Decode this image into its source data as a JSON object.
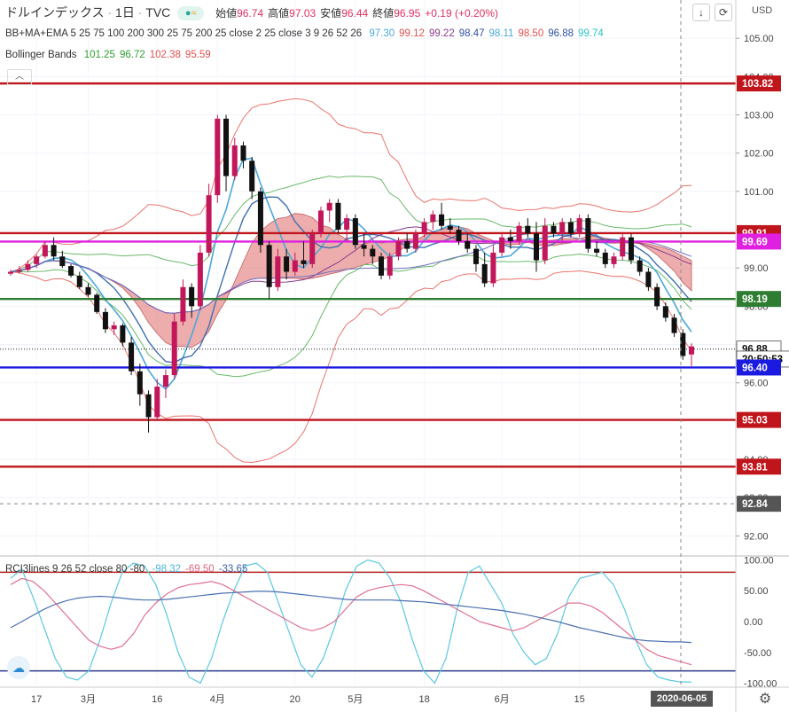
{
  "header": {
    "symbol": "ドルインデックス",
    "interval": "1日",
    "source": "TVC",
    "ohlc": [
      {
        "label": "始値",
        "value": "96.74"
      },
      {
        "label": "高値",
        "value": "97.03"
      },
      {
        "label": "安値",
        "value": "96.44"
      },
      {
        "label": "終値",
        "value": "96.95"
      }
    ],
    "change": "+0.19 (+0.20%)",
    "currency": "USD"
  },
  "indicators": {
    "bbma_label": "BB+MA+EMA 5 25 75 100 200 300 25 75 200 25 close 2 25 close 3 9 26 52 26",
    "bbma_values": [
      {
        "v": "97.30",
        "color": "#4aa8d8"
      },
      {
        "v": "99.12",
        "color": "#e05050"
      },
      {
        "v": "99.22",
        "color": "#8a3a8a"
      },
      {
        "v": "98.47",
        "color": "#3050a0"
      },
      {
        "v": "98.11",
        "color": "#4aa8d8"
      },
      {
        "v": "98.50",
        "color": "#e05050"
      },
      {
        "v": "96.88",
        "color": "#3050a0"
      },
      {
        "v": "99.74",
        "color": "#2ec4c4"
      }
    ],
    "bb_label": "Bollinger Bands",
    "bb_values": [
      {
        "v": "101.25",
        "color": "#2e9e2e"
      },
      {
        "v": "96.72",
        "color": "#2e9e2e"
      },
      {
        "v": "102.38",
        "color": "#e05050"
      },
      {
        "v": "95.59",
        "color": "#e05050"
      }
    ],
    "rci_label": "RCI3lines 9 26 52 close 80 -80",
    "rci_values": [
      {
        "v": "-98.32",
        "color": "#4ab8d8"
      },
      {
        "v": "-69.50",
        "color": "#e06080"
      },
      {
        "v": "-33.65",
        "color": "#4060a0"
      }
    ]
  },
  "price_axis": {
    "ticks": [
      "105.00",
      "104.00",
      "103.00",
      "102.00",
      "101.00",
      "100.00",
      "99.00",
      "98.00",
      "97.00",
      "96.00",
      "95.00",
      "94.00",
      "93.00",
      "92.00"
    ],
    "tags": [
      {
        "name": "level-103-82",
        "text": "103.82",
        "bg": "#c0151b",
        "color": "#ffffff"
      },
      {
        "name": "level-99-91",
        "text": "99.91",
        "bg": "#c0151b",
        "color": "#ffffff"
      },
      {
        "name": "level-99-69",
        "text": "99.69",
        "bg": "#e020e0",
        "color": "#ffffff"
      },
      {
        "name": "level-98-19",
        "text": "98.19",
        "bg": "#2e7d32",
        "color": "#ffffff"
      },
      {
        "name": "last-price",
        "text": "96.88",
        "bg": "#ffffff",
        "color": "#111111"
      },
      {
        "name": "countdown",
        "text": "20:50:53",
        "bg": "#ffffff",
        "color": "#111111"
      },
      {
        "name": "level-96-40",
        "text": "96.40",
        "bg": "#1a1ae0",
        "color": "#ffffff"
      },
      {
        "name": "level-95-03",
        "text": "95.03",
        "bg": "#c0151b",
        "color": "#ffffff"
      },
      {
        "name": "level-93-81",
        "text": "93.81",
        "bg": "#c0151b",
        "color": "#ffffff"
      },
      {
        "name": "crosshair-price",
        "text": "92.84",
        "bg": "#555555",
        "color": "#ffffff"
      }
    ]
  },
  "rci_axis": {
    "ticks": [
      "100.00",
      "50.00",
      "0.00",
      "-50.00",
      "-100.00"
    ]
  },
  "time_axis": {
    "ticks": [
      "17",
      "3月",
      "16",
      "4月",
      "20",
      "5月",
      "18",
      "6月",
      "15"
    ],
    "crosshair_date": "2020-06-05"
  },
  "chart_data": {
    "type": "candlestick",
    "title": "ドルインデックス 1日 TVC",
    "ylim": [
      91.5,
      106.0
    ],
    "horizontal_levels": [
      {
        "value": 103.82,
        "color": "#c0151b"
      },
      {
        "value": 99.91,
        "color": "#c0151b"
      },
      {
        "value": 99.69,
        "color": "#e020e0"
      },
      {
        "value": 98.19,
        "color": "#2e7d32"
      },
      {
        "value": 96.4,
        "color": "#1a1ae0"
      },
      {
        "value": 95.03,
        "color": "#c0151b"
      },
      {
        "value": 93.81,
        "color": "#c0151b"
      }
    ],
    "last_price": 96.88,
    "candles": [
      {
        "o": 98.85,
        "h": 98.95,
        "l": 98.8,
        "c": 98.9
      },
      {
        "o": 98.9,
        "h": 99.05,
        "l": 98.85,
        "c": 98.95
      },
      {
        "o": 98.95,
        "h": 99.2,
        "l": 98.9,
        "c": 99.1
      },
      {
        "o": 99.1,
        "h": 99.35,
        "l": 99.0,
        "c": 99.3
      },
      {
        "o": 99.3,
        "h": 99.7,
        "l": 99.25,
        "c": 99.6
      },
      {
        "o": 99.6,
        "h": 99.8,
        "l": 99.2,
        "c": 99.3
      },
      {
        "o": 99.3,
        "h": 99.45,
        "l": 99.0,
        "c": 99.05
      },
      {
        "o": 99.05,
        "h": 99.1,
        "l": 98.75,
        "c": 98.8
      },
      {
        "o": 98.8,
        "h": 98.9,
        "l": 98.45,
        "c": 98.5
      },
      {
        "o": 98.5,
        "h": 98.6,
        "l": 98.25,
        "c": 98.3
      },
      {
        "o": 98.3,
        "h": 98.35,
        "l": 97.8,
        "c": 97.85
      },
      {
        "o": 97.85,
        "h": 97.95,
        "l": 97.3,
        "c": 97.4
      },
      {
        "o": 97.4,
        "h": 97.6,
        "l": 97.25,
        "c": 97.5
      },
      {
        "o": 97.5,
        "h": 97.55,
        "l": 96.95,
        "c": 97.05
      },
      {
        "o": 97.05,
        "h": 97.2,
        "l": 96.2,
        "c": 96.3
      },
      {
        "o": 96.3,
        "h": 96.5,
        "l": 95.4,
        "c": 95.7
      },
      {
        "o": 95.7,
        "h": 95.8,
        "l": 94.7,
        "c": 95.1
      },
      {
        "o": 95.1,
        "h": 96.1,
        "l": 95.0,
        "c": 95.9
      },
      {
        "o": 95.9,
        "h": 96.35,
        "l": 95.6,
        "c": 96.2
      },
      {
        "o": 96.2,
        "h": 97.8,
        "l": 96.1,
        "c": 97.6
      },
      {
        "o": 97.6,
        "h": 98.7,
        "l": 97.5,
        "c": 98.5
      },
      {
        "o": 98.5,
        "h": 98.6,
        "l": 97.7,
        "c": 98.0
      },
      {
        "o": 98.0,
        "h": 99.6,
        "l": 97.9,
        "c": 99.4
      },
      {
        "o": 99.4,
        "h": 101.2,
        "l": 99.3,
        "c": 100.9
      },
      {
        "o": 100.9,
        "h": 103.0,
        "l": 100.7,
        "c": 102.9
      },
      {
        "o": 102.9,
        "h": 103.0,
        "l": 101.0,
        "c": 101.4
      },
      {
        "o": 101.4,
        "h": 102.4,
        "l": 101.3,
        "c": 102.2
      },
      {
        "o": 102.2,
        "h": 102.3,
        "l": 101.6,
        "c": 101.8
      },
      {
        "o": 101.8,
        "h": 101.9,
        "l": 100.8,
        "c": 101.0
      },
      {
        "o": 101.0,
        "h": 101.1,
        "l": 99.4,
        "c": 99.6
      },
      {
        "o": 99.6,
        "h": 99.7,
        "l": 98.2,
        "c": 98.5
      },
      {
        "o": 98.5,
        "h": 99.5,
        "l": 98.4,
        "c": 99.3
      },
      {
        "o": 99.3,
        "h": 99.5,
        "l": 98.7,
        "c": 98.9
      },
      {
        "o": 98.9,
        "h": 99.4,
        "l": 98.8,
        "c": 99.2
      },
      {
        "o": 99.2,
        "h": 99.7,
        "l": 99.0,
        "c": 99.1
      },
      {
        "o": 99.1,
        "h": 100.0,
        "l": 99.0,
        "c": 99.9
      },
      {
        "o": 99.9,
        "h": 100.6,
        "l": 99.8,
        "c": 100.5
      },
      {
        "o": 100.5,
        "h": 100.8,
        "l": 100.2,
        "c": 100.7
      },
      {
        "o": 100.7,
        "h": 100.8,
        "l": 99.9,
        "c": 100.0
      },
      {
        "o": 100.0,
        "h": 100.4,
        "l": 99.7,
        "c": 100.3
      },
      {
        "o": 100.3,
        "h": 100.4,
        "l": 99.5,
        "c": 99.6
      },
      {
        "o": 99.6,
        "h": 99.9,
        "l": 99.3,
        "c": 99.5
      },
      {
        "o": 99.5,
        "h": 99.6,
        "l": 99.1,
        "c": 99.3
      },
      {
        "o": 99.3,
        "h": 99.4,
        "l": 98.7,
        "c": 98.8
      },
      {
        "o": 98.8,
        "h": 99.4,
        "l": 98.7,
        "c": 99.3
      },
      {
        "o": 99.3,
        "h": 99.8,
        "l": 99.2,
        "c": 99.7
      },
      {
        "o": 99.7,
        "h": 99.9,
        "l": 99.4,
        "c": 99.5
      },
      {
        "o": 99.5,
        "h": 100.0,
        "l": 99.4,
        "c": 99.9
      },
      {
        "o": 99.9,
        "h": 100.3,
        "l": 99.8,
        "c": 100.2
      },
      {
        "o": 100.2,
        "h": 100.5,
        "l": 100.0,
        "c": 100.4
      },
      {
        "o": 100.4,
        "h": 100.7,
        "l": 100.0,
        "c": 100.1
      },
      {
        "o": 100.1,
        "h": 100.3,
        "l": 99.9,
        "c": 100.0
      },
      {
        "o": 100.0,
        "h": 100.1,
        "l": 99.6,
        "c": 99.7
      },
      {
        "o": 99.7,
        "h": 99.9,
        "l": 99.4,
        "c": 99.5
      },
      {
        "o": 99.5,
        "h": 99.6,
        "l": 98.9,
        "c": 99.1
      },
      {
        "o": 99.1,
        "h": 99.4,
        "l": 98.5,
        "c": 98.6
      },
      {
        "o": 98.6,
        "h": 99.6,
        "l": 98.5,
        "c": 99.4
      },
      {
        "o": 99.4,
        "h": 99.9,
        "l": 99.3,
        "c": 99.8
      },
      {
        "o": 99.8,
        "h": 100.0,
        "l": 99.5,
        "c": 99.7
      },
      {
        "o": 99.7,
        "h": 100.2,
        "l": 99.6,
        "c": 100.1
      },
      {
        "o": 100.1,
        "h": 100.3,
        "l": 99.8,
        "c": 99.9
      },
      {
        "o": 99.9,
        "h": 100.2,
        "l": 98.9,
        "c": 99.2
      },
      {
        "o": 99.2,
        "h": 100.3,
        "l": 99.1,
        "c": 100.1
      },
      {
        "o": 100.1,
        "h": 100.2,
        "l": 99.8,
        "c": 99.9
      },
      {
        "o": 99.9,
        "h": 100.3,
        "l": 99.7,
        "c": 100.2
      },
      {
        "o": 100.2,
        "h": 100.3,
        "l": 99.8,
        "c": 99.9
      },
      {
        "o": 99.9,
        "h": 100.4,
        "l": 99.8,
        "c": 100.3
      },
      {
        "o": 100.3,
        "h": 100.4,
        "l": 99.4,
        "c": 99.5
      },
      {
        "o": 99.5,
        "h": 99.7,
        "l": 99.3,
        "c": 99.4
      },
      {
        "o": 99.4,
        "h": 99.5,
        "l": 99.0,
        "c": 99.1
      },
      {
        "o": 99.1,
        "h": 99.4,
        "l": 99.0,
        "c": 99.3
      },
      {
        "o": 99.3,
        "h": 99.9,
        "l": 99.2,
        "c": 99.8
      },
      {
        "o": 99.8,
        "h": 99.9,
        "l": 99.1,
        "c": 99.2
      },
      {
        "o": 99.2,
        "h": 99.3,
        "l": 98.8,
        "c": 98.9
      },
      {
        "o": 98.9,
        "h": 99.0,
        "l": 98.4,
        "c": 98.5
      },
      {
        "o": 98.5,
        "h": 98.6,
        "l": 97.9,
        "c": 98.0
      },
      {
        "o": 98.0,
        "h": 98.1,
        "l": 97.6,
        "c": 97.7
      },
      {
        "o": 97.7,
        "h": 97.8,
        "l": 97.2,
        "c": 97.3
      },
      {
        "o": 97.3,
        "h": 97.4,
        "l": 96.6,
        "c": 96.7
      },
      {
        "o": 96.74,
        "h": 97.03,
        "l": 96.44,
        "c": 96.95
      }
    ],
    "rci": {
      "ylim": [
        -105,
        105
      ],
      "levels": [
        80,
        -80
      ],
      "series": [
        {
          "name": "RCI 9",
          "color": "#5bc8e0",
          "values": [
            70,
            85,
            40,
            -10,
            -60,
            -90,
            -95,
            -80,
            -30,
            30,
            80,
            95,
            90,
            60,
            10,
            -50,
            -90,
            -100,
            -60,
            0,
            50,
            90,
            95,
            80,
            30,
            -20,
            -70,
            -90,
            -60,
            -10,
            50,
            90,
            100,
            95,
            70,
            30,
            -30,
            -80,
            -100,
            -60,
            20,
            80,
            90,
            60,
            30,
            -20,
            -50,
            -70,
            -60,
            -20,
            40,
            70,
            75,
            80,
            60,
            20,
            -30,
            -70,
            -90,
            -95,
            -98,
            -98
          ]
        },
        {
          "name": "RCI 26",
          "color": "#e07090",
          "values": [
            60,
            70,
            65,
            50,
            30,
            10,
            -10,
            -30,
            -40,
            -45,
            -40,
            -20,
            10,
            30,
            45,
            55,
            60,
            62,
            65,
            60,
            50,
            40,
            30,
            20,
            10,
            0,
            -10,
            -15,
            -10,
            0,
            20,
            40,
            50,
            55,
            58,
            60,
            58,
            50,
            40,
            30,
            20,
            10,
            0,
            -5,
            -10,
            -15,
            -10,
            0,
            10,
            20,
            30,
            30,
            25,
            15,
            0,
            -15,
            -30,
            -45,
            -55,
            -60,
            -65,
            -70
          ]
        },
        {
          "name": "RCI 52",
          "color": "#4a70b0",
          "values": [
            -10,
            0,
            10,
            20,
            28,
            34,
            38,
            40,
            41,
            40,
            38,
            36,
            35,
            35,
            36,
            38,
            40,
            42,
            44,
            46,
            47,
            48,
            49,
            49,
            48,
            46,
            44,
            42,
            40,
            38,
            36,
            35,
            35,
            35,
            35,
            34,
            33,
            32,
            30,
            28,
            26,
            24,
            22,
            20,
            18,
            15,
            12,
            8,
            4,
            0,
            -5,
            -10,
            -14,
            -18,
            -22,
            -26,
            -29,
            -31,
            -32,
            -33,
            -33,
            -34
          ]
        }
      ]
    }
  }
}
